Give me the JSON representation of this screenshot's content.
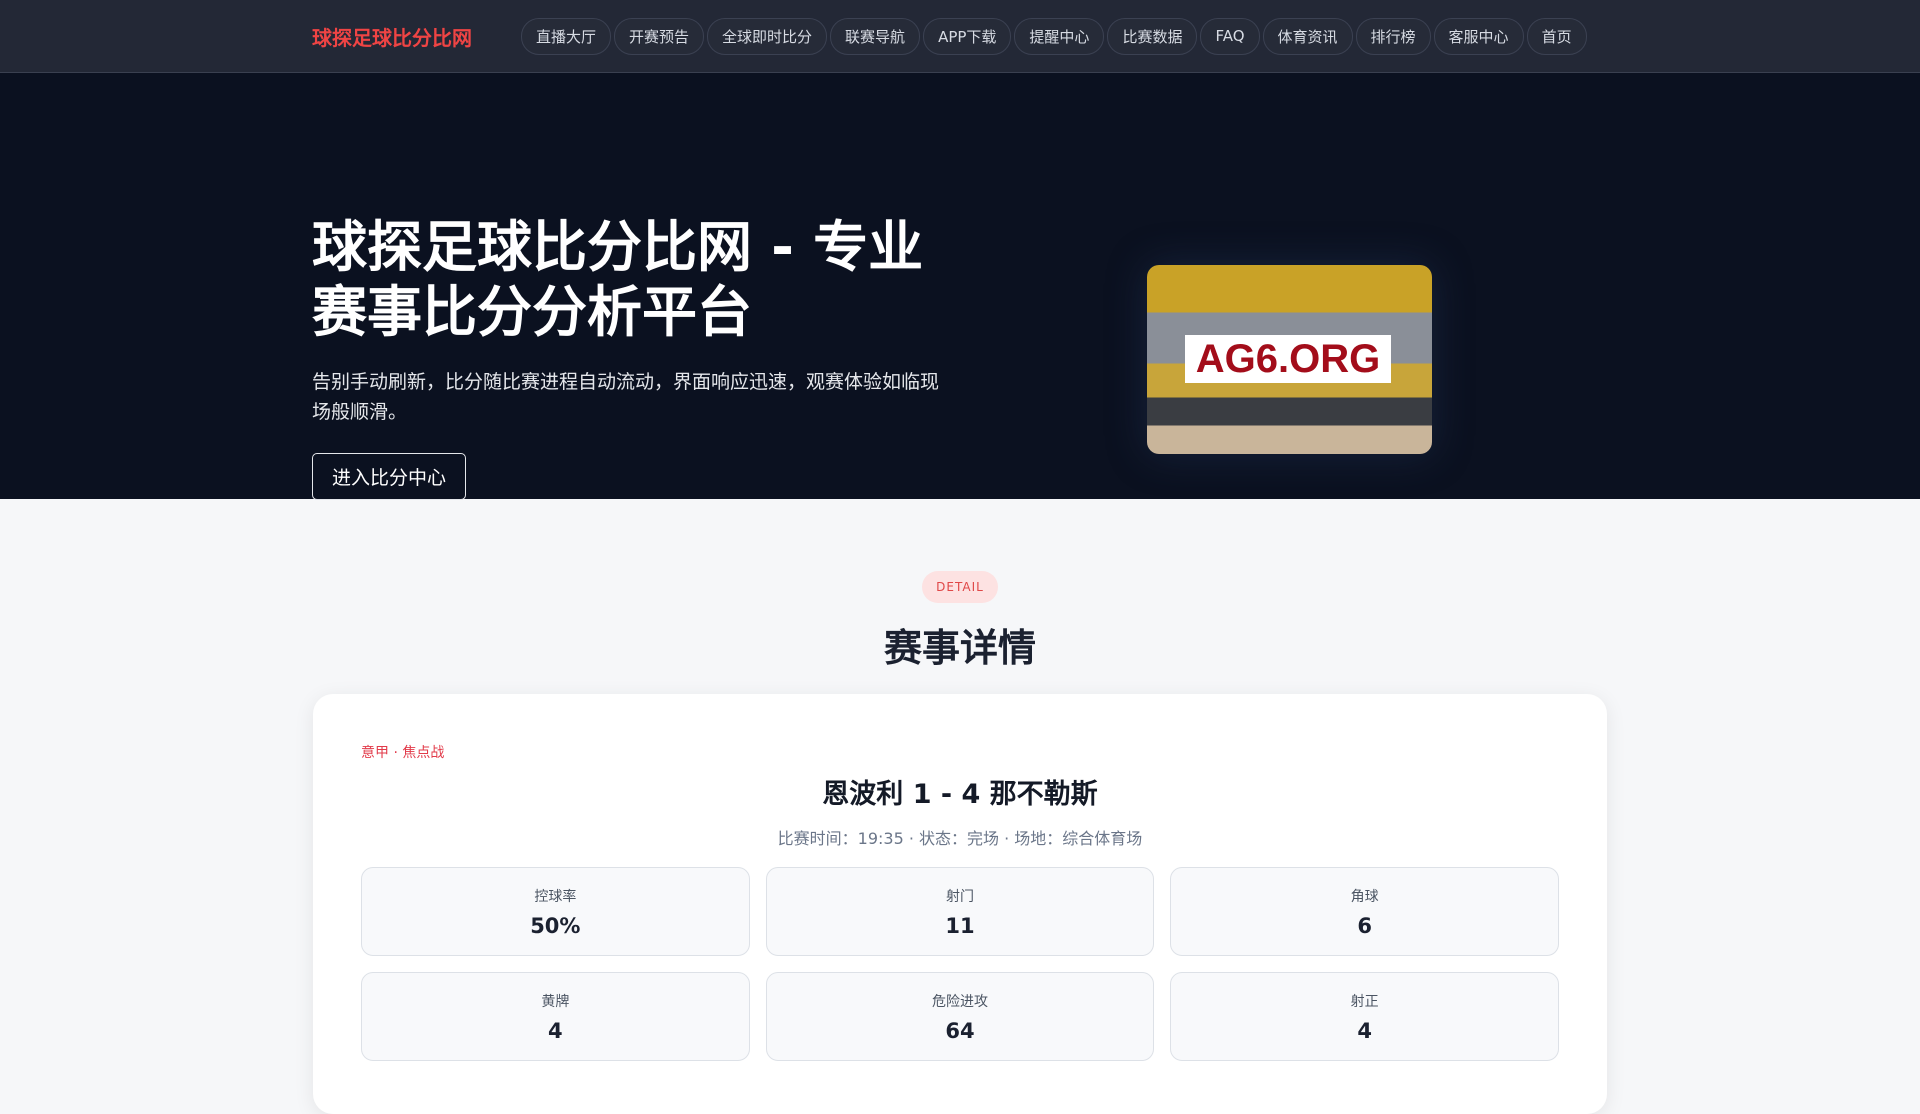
{
  "nav": {
    "logo": "球探足球比分比网",
    "items": [
      "直播大厅",
      "开赛预告",
      "全球即时比分",
      "联赛导航",
      "APP下载",
      "提醒中心",
      "比赛数据",
      "FAQ",
      "体育资讯",
      "排行榜",
      "客服中心",
      "首页"
    ]
  },
  "hero": {
    "title": "球探足球比分比网 - 专业赛事比分分析平台",
    "subtitle": "告别手动刷新，比分随比赛进程自动流动，界面响应迅速，观赛体验如临现场般顺滑。",
    "cta": "进入比分中心",
    "image_watermark": "AG6.ORG"
  },
  "section": {
    "badge": "DETAIL",
    "heading": "赛事详情"
  },
  "match": {
    "league": "意甲 · 焦点战",
    "title": "恩波利 1 - 4 那不勒斯",
    "meta": "比赛时间：19:35 · 状态：完场 · 场地：综合体育场",
    "stats": [
      {
        "label": "控球率",
        "value": "50%"
      },
      {
        "label": "射门",
        "value": "11"
      },
      {
        "label": "角球",
        "value": "6"
      },
      {
        "label": "黄牌",
        "value": "4"
      },
      {
        "label": "危险进攻",
        "value": "64"
      },
      {
        "label": "射正",
        "value": "4"
      }
    ]
  }
}
